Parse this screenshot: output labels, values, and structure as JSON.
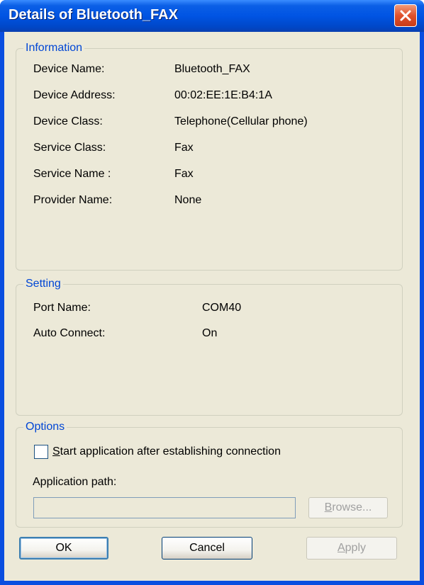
{
  "window": {
    "title": "Details of Bluetooth_FAX",
    "close_icon": "close-icon"
  },
  "information": {
    "label": "Information",
    "rows": [
      {
        "label": "Device Name:",
        "value": "Bluetooth_FAX"
      },
      {
        "label": "Device Address:",
        "value": "00:02:EE:1E:B4:1A"
      },
      {
        "label": "Device Class:",
        "value": "Telephone(Cellular phone)"
      },
      {
        "label": "Service Class:",
        "value": "Fax"
      },
      {
        "label": "Service Name :",
        "value": "Fax"
      },
      {
        "label": "Provider Name:",
        "value": "None"
      }
    ]
  },
  "setting": {
    "label": "Setting",
    "rows": [
      {
        "label": "Port Name:",
        "value": "COM40"
      },
      {
        "label": "Auto Connect:",
        "value": "On"
      }
    ]
  },
  "options": {
    "label": "Options",
    "checkbox_accel": "S",
    "checkbox_rest": "tart application after establishing connection",
    "checkbox_checked": false,
    "path_label": "Application path:",
    "path_value": "",
    "browse_accel": "B",
    "browse_rest": "rowse..."
  },
  "buttons": {
    "ok": "OK",
    "cancel": "Cancel",
    "apply_accel": "A",
    "apply_rest": "pply"
  },
  "colors": {
    "title_bar": "#0054e3",
    "dialog_bg": "#ece9d8",
    "group_label": "#0046d5",
    "disabled_text": "#a0a0a0"
  }
}
